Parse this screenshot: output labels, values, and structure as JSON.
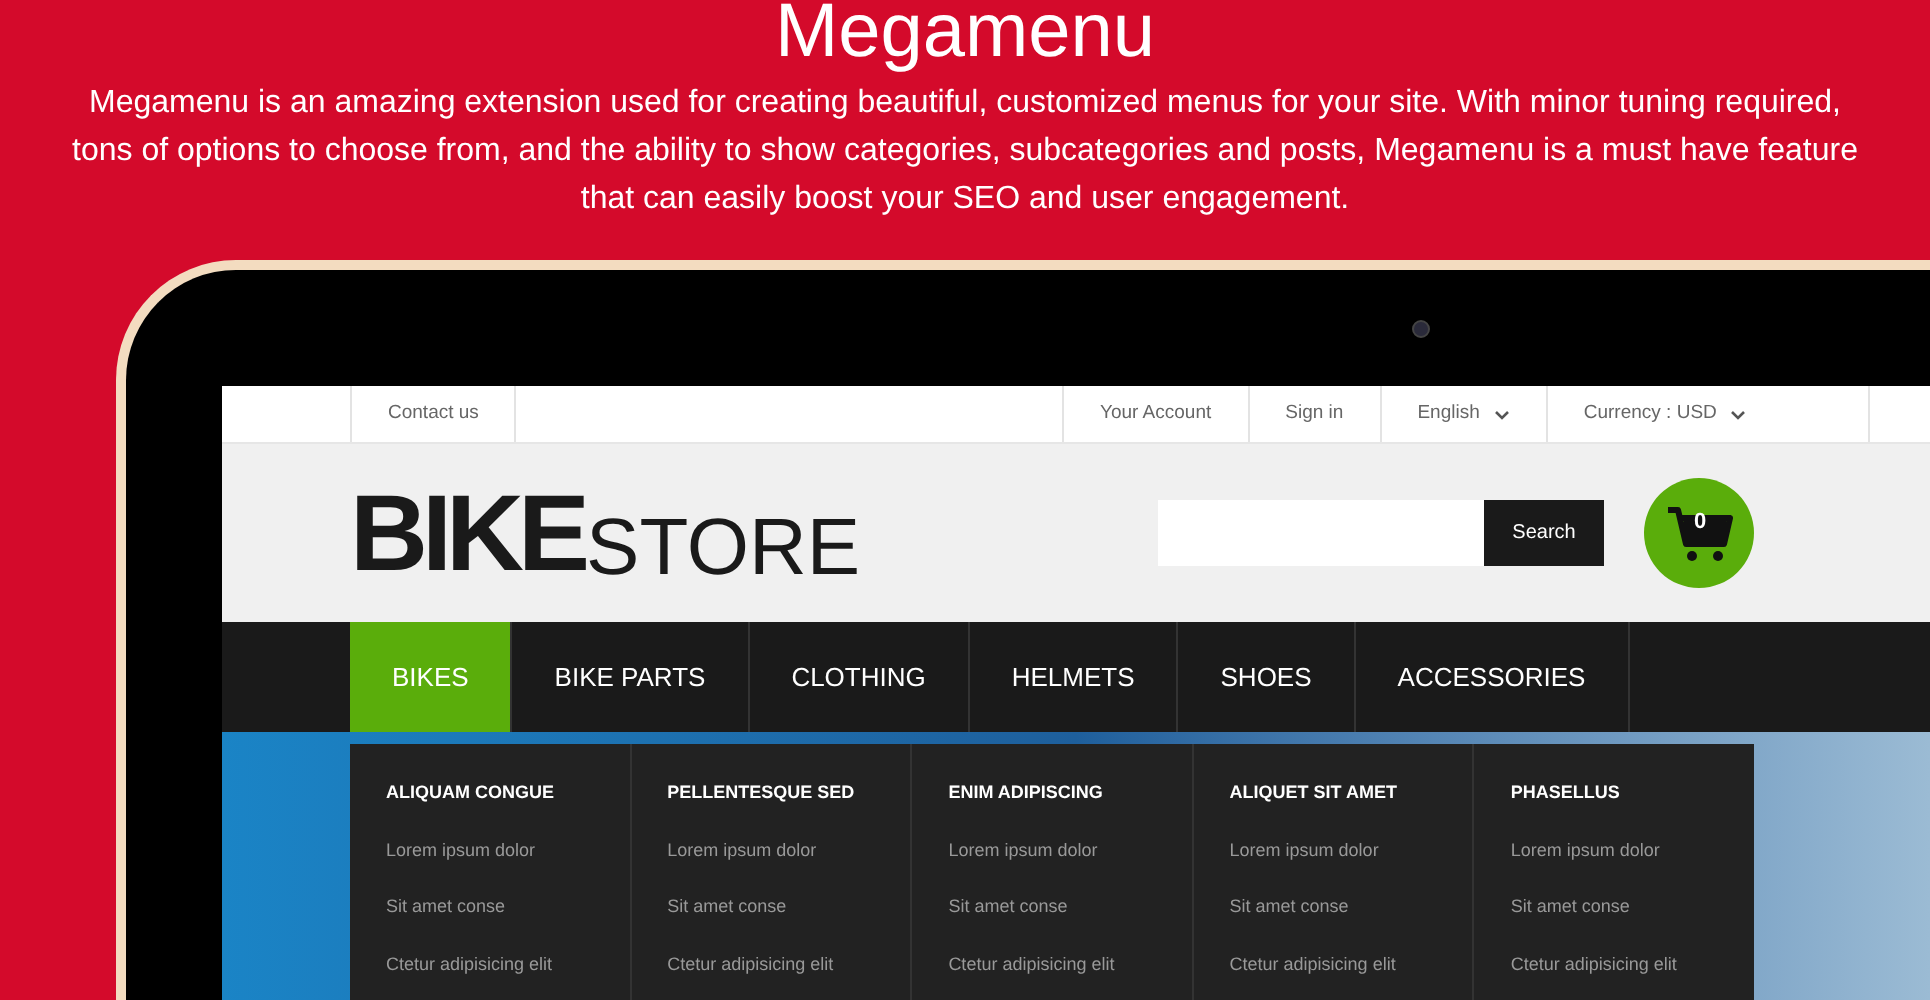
{
  "title": "Megamenu",
  "description": "Megamenu is an amazing extension used for creating beautiful, customized menus for your site. With minor tuning required, tons of options to choose from, and the ability to show categories, subcategories and posts, Megamenu is a must have feature that can easily boost your SEO and user engagement.",
  "store": {
    "top_bar": {
      "left": [
        {
          "label": "Contact us",
          "kind": "link"
        }
      ],
      "right": [
        {
          "label": "Your Account",
          "kind": "link"
        },
        {
          "label": "Sign in",
          "kind": "link"
        },
        {
          "label": "English",
          "kind": "dropdown"
        },
        {
          "label": "Currency : USD",
          "kind": "dropdown"
        }
      ]
    },
    "logo": {
      "bold": "BIKE",
      "light": "STORE"
    },
    "search": {
      "button": "Search"
    },
    "cart": {
      "count": "0"
    },
    "nav": [
      {
        "label": "BIKES",
        "selected": true
      },
      {
        "label": "BIKE PARTS",
        "selected": false
      },
      {
        "label": "CLOTHING",
        "selected": false
      },
      {
        "label": "HELMETS",
        "selected": false
      },
      {
        "label": "SHOES",
        "selected": false
      },
      {
        "label": "ACCESSORIES",
        "selected": false
      }
    ],
    "megamenu": [
      {
        "heading": "ALIQUAM CONGUE",
        "links": [
          "Lorem ipsum dolor",
          "Sit amet conse",
          "Ctetur adipisicing elit"
        ]
      },
      {
        "heading": "PELLENTESQUE SED",
        "links": [
          "Lorem ipsum dolor",
          "Sit amet conse",
          "Ctetur adipisicing elit"
        ]
      },
      {
        "heading": "ENIM ADIPISCING",
        "links": [
          "Lorem ipsum dolor",
          "Sit amet conse",
          "Ctetur adipisicing elit"
        ]
      },
      {
        "heading": "ALIQUET SIT AMET",
        "links": [
          "Lorem ipsum dolor",
          "Sit amet conse",
          "Ctetur adipisicing elit"
        ]
      },
      {
        "heading": "PHASELLUS",
        "links": [
          "Lorem ipsum dolor",
          "Sit amet conse",
          "Ctetur adipisicing elit"
        ]
      }
    ]
  }
}
